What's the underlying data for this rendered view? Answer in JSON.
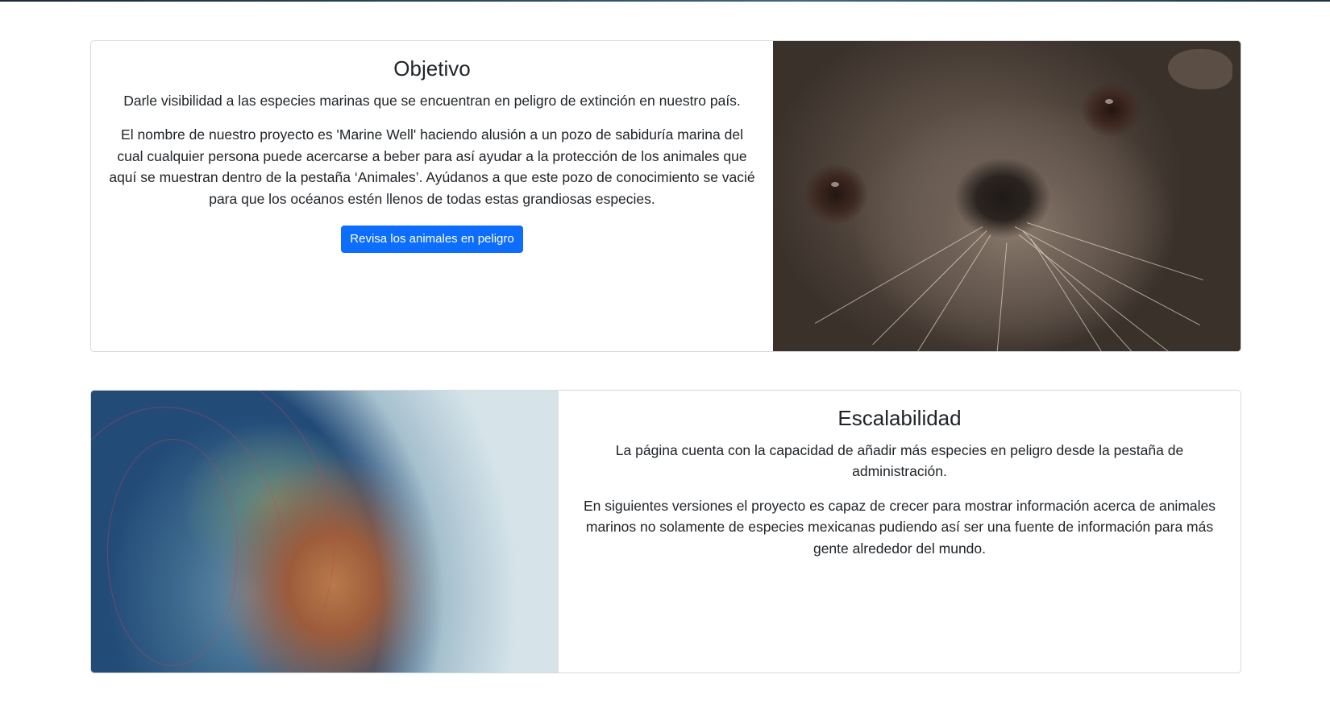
{
  "colors": {
    "primary_button": "#0d6efd",
    "card_border": "#d7d9dc",
    "text": "#212529"
  },
  "sections": {
    "objetivo": {
      "title": "Objetivo",
      "paragraph_1": "Darle visibilidad a las especies marinas que se encuentran en peligro de extinción en nuestro país.",
      "paragraph_2": "El nombre de nuestro proyecto es 'Marine Well' haciendo alusión a un pozo de sabiduría marina del cual cualquier persona puede acercarse a beber para así ayudar a la protección de los animales que aquí se muestran dentro de la pestaña ‘Animales’. Ayúdanos a que este pozo de conocimiento se vacié para que los océanos estén llenos de todas estas grandiosas especies.",
      "button_label": "Revisa los animales en peligro",
      "image_icon": "sea-lion-photo"
    },
    "escalabilidad": {
      "title": "Escalabilidad",
      "paragraph_1": "La página cuenta con la capacidad de añadir más especies en peligro desde la pestaña de administración.",
      "paragraph_2": "En siguientes versiones el proyecto es capaz de crecer para mostrar información acerca de animales marinos no solamente de especies mexicanas pudiendo así ser una fuente de información para más gente alrededor del mundo.",
      "image_icon": "globe-photo"
    }
  }
}
